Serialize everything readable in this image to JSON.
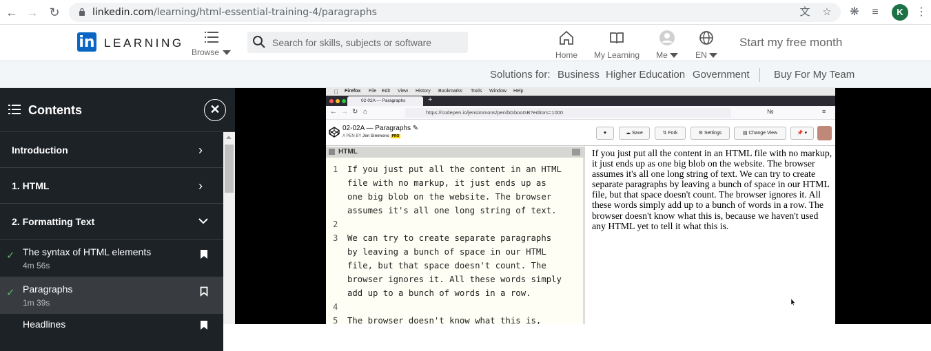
{
  "browser": {
    "url_host": "linkedin.com",
    "url_path": "/learning/html-essential-training-4/paragraphs",
    "profile_initial": "K"
  },
  "header": {
    "logo_text": "LEARNING",
    "browse_label": "Browse",
    "search_placeholder": "Search for skills, subjects or software",
    "nav": {
      "home": "Home",
      "my_learning": "My Learning",
      "me": "Me",
      "lang": "EN"
    },
    "cta": "Start my free month"
  },
  "subnav": {
    "prefix": "Solutions for:",
    "items": [
      "Business",
      "Higher Education",
      "Government"
    ],
    "buy": "Buy For My Team"
  },
  "sidebar": {
    "title": "Contents",
    "sections": [
      {
        "label": "Introduction"
      },
      {
        "label": "1. HTML"
      },
      {
        "label": "2. Formatting Text"
      }
    ],
    "videos": [
      {
        "title": "The syntax of HTML elements",
        "duration": "4m 56s"
      },
      {
        "title": "Paragraphs",
        "duration": "1m 39s"
      },
      {
        "title": "Headlines",
        "duration": ""
      }
    ]
  },
  "video": {
    "mac_menu": [
      "Firefox",
      "File",
      "Edit",
      "View",
      "History",
      "Bookmarks",
      "Tools",
      "Window",
      "Help"
    ],
    "tab_title": "02-02A — Paragraphs",
    "ff_url": "https://codepen.io/jensimmons/pen/bGbooGB?editors=1000",
    "pen_title": "02-02A — Paragraphs",
    "pen_author_prefix": "A PEN BY",
    "pen_author": "Jen Simmons",
    "pen_badge": "PRO",
    "buttons": [
      "Save",
      "Fork",
      "Settings",
      "Change View"
    ],
    "editor_label": "HTML",
    "code_lines": [
      {
        "n": "1",
        "text": "If you just put all the content in an HTML"
      },
      {
        "n": "",
        "text": "file with no markup, it just ends up as"
      },
      {
        "n": "",
        "text": "one big blob on the website. The browser"
      },
      {
        "n": "",
        "text": "assumes it's all one long string of text."
      },
      {
        "n": "2",
        "text": ""
      },
      {
        "n": "3",
        "text": "We can try to create separate paragraphs"
      },
      {
        "n": "",
        "text": "by leaving a bunch of space in our HTML"
      },
      {
        "n": "",
        "text": "file, but that space doesn't count. The"
      },
      {
        "n": "",
        "text": "browser ignores it. All these words simply"
      },
      {
        "n": "",
        "text": "add up to a bunch of words in a row."
      },
      {
        "n": "4",
        "text": ""
      },
      {
        "n": "5",
        "text": "The browser doesn't know what this is,"
      }
    ],
    "preview_text": "If you just put all the content in an HTML file with no markup, it just ends up as one big blob on the website. The browser assumes it's all one long string of text. We can try to create separate paragraphs by leaving a bunch of space in our HTML file, but that space doesn't count. The browser ignores it. All these words simply add up to a bunch of words in a row. The browser doesn't know what this is, because we haven't used any HTML yet to tell it what this is."
  },
  "colors": {
    "linkedin_blue": "#0a66c2",
    "sidebar_bg": "#1d2226",
    "check_green": "#5ab36b"
  }
}
